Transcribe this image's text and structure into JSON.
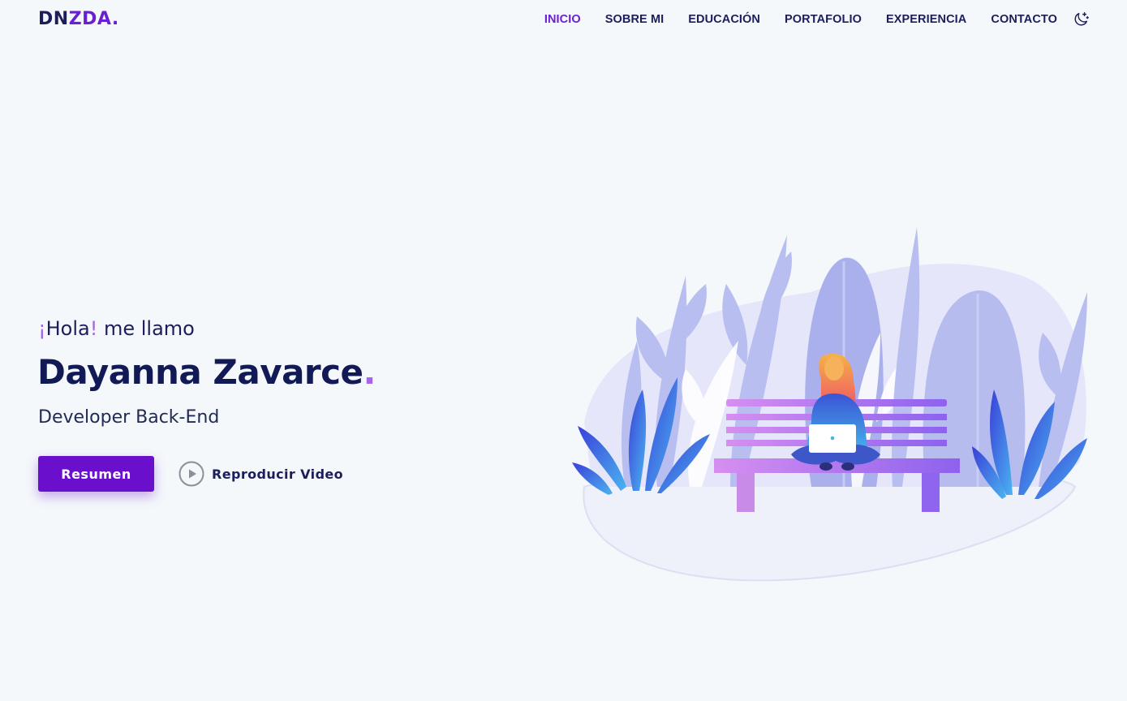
{
  "header": {
    "logo": {
      "part1": "DN",
      "part2": "ZDA",
      "dot": "."
    },
    "nav": [
      {
        "label": "INICIO",
        "active": true
      },
      {
        "label": "SOBRE MI",
        "active": false
      },
      {
        "label": "EDUCACIÓN",
        "active": false
      },
      {
        "label": "PORTAFOLIO",
        "active": false
      },
      {
        "label": "EXPERIENCIA",
        "active": false
      },
      {
        "label": "CONTACTO",
        "active": false
      }
    ],
    "theme_toggle_icon": "moon-icon"
  },
  "hero": {
    "greeting": {
      "open_excl": "¡",
      "hola": "Hola",
      "close_excl": "!",
      "rest": " me llamo"
    },
    "name": "Dayanna Zavarce",
    "name_dot": ".",
    "role": "Developer Back-End",
    "resume_button": "Resumen",
    "video_link": "Reproducir Video",
    "video_icon": "play-circle-icon",
    "illustration": "woman-on-bench-with-laptop-illustration"
  },
  "colors": {
    "background": "#f4f8fb",
    "primary": "#6a10cc",
    "accent": "#a566e6",
    "text_dark": "#1c1e5c"
  }
}
